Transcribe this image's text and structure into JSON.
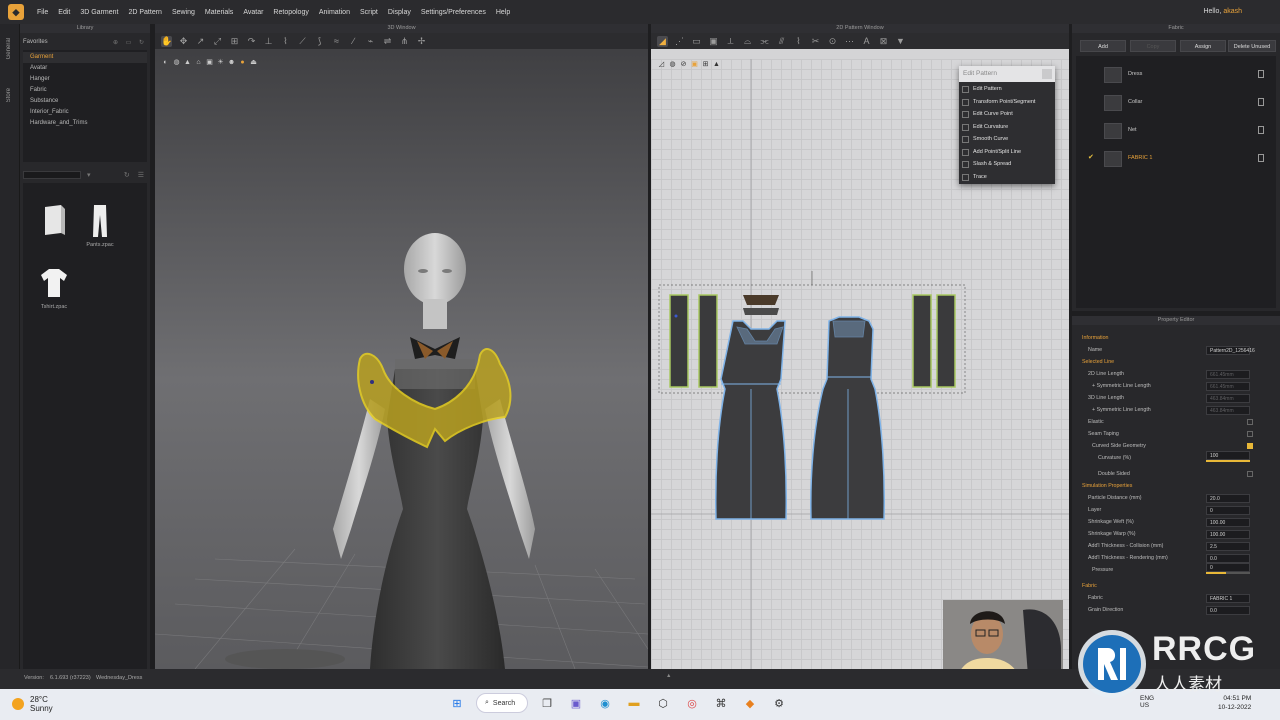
{
  "menubar": {
    "items": [
      "File",
      "Edit",
      "3D Garment",
      "2D Pattern",
      "Sewing",
      "Materials",
      "Avatar",
      "Retopology",
      "Animation",
      "Script",
      "Display",
      "Settings/Preferences",
      "Help"
    ],
    "greeting": "Hello,",
    "username": "akash"
  },
  "side_tabs": [
    "General",
    "Store"
  ],
  "library": {
    "header": "Library",
    "favorites_label": "Favorites",
    "tree": [
      "Garment",
      "Avatar",
      "Hanger",
      "Fabric",
      "Substance",
      "Interior_Fabric",
      "Hardware_and_Trims"
    ],
    "selected_tree_index": 0,
    "files": [
      {
        "name": ""
      },
      {
        "name": "Pants.zpac"
      },
      {
        "name": "Tshirt.zpac"
      }
    ]
  },
  "window3d": {
    "header": "3D Window"
  },
  "window2d": {
    "header": "2D Pattern Window",
    "popup": {
      "title": "Edit Pattern",
      "items": [
        "Edit Pattern",
        "Transform Point/Segment",
        "Edit Curve Point",
        "Edit Curvature",
        "Smooth Curve",
        "Add Point/Split Line",
        "Slash & Spread",
        "Trace"
      ]
    }
  },
  "fabric_panel": {
    "header": "Fabric",
    "buttons": {
      "add": "Add",
      "copy": "Copy",
      "assign": "Assign",
      "delete_unused": "Delete Unused"
    },
    "fabrics": [
      {
        "name": "Dress",
        "selected": false
      },
      {
        "name": "Collar",
        "selected": false
      },
      {
        "name": "Net",
        "selected": false
      },
      {
        "name": "FABRIC 1",
        "selected": true
      }
    ]
  },
  "property_editor": {
    "header": "Property Editor",
    "rows": [
      {
        "label": "Information",
        "type": "section"
      },
      {
        "label": "Name",
        "value": "Pattern2D_1256416"
      },
      {
        "label": "Selected Line",
        "type": "section"
      },
      {
        "label": "2D Line Length",
        "value": "661.45mm",
        "dim": true
      },
      {
        "label": "+ Symmetric Line Length",
        "value": "661.45mm",
        "dim": true,
        "sub": true
      },
      {
        "label": "3D Line Length",
        "value": "463.84mm",
        "dim": true
      },
      {
        "label": "+ Symmetric Line Length",
        "value": "463.84mm",
        "dim": true,
        "sub": true
      },
      {
        "label": "Elastic",
        "check": false
      },
      {
        "label": "Seam Taping",
        "check": false
      },
      {
        "label": "Curved Side Geometry",
        "check": true,
        "sub": true
      },
      {
        "label": "Curvature (%)",
        "value": "100",
        "slider": 1.0,
        "sub2": true
      },
      {
        "label": "Double Sided",
        "check": false,
        "sub2": true
      },
      {
        "label": "Simulation Properties",
        "type": "section"
      },
      {
        "label": "Particle Distance (mm)",
        "value": "20.0"
      },
      {
        "label": "Layer",
        "value": "0"
      },
      {
        "label": "Shrinkage Weft (%)",
        "value": "100.00"
      },
      {
        "label": "Shrinkage Warp (%)",
        "value": "100.00"
      },
      {
        "label": "Add'l Thickness - Collision (mm)",
        "value": "2.5"
      },
      {
        "label": "Add'l Thickness - Rendering (mm)",
        "value": "0.0"
      },
      {
        "label": "Pressure",
        "value": "0",
        "slider": 0.45,
        "sub": true
      },
      {
        "label": "Fabric",
        "type": "section"
      },
      {
        "label": "Fabric",
        "value": "FABRIC 1"
      },
      {
        "label": "Grain Direction",
        "value": "0.0"
      }
    ]
  },
  "statusbar": {
    "version_label": "Version:",
    "version": "6.1.693 (r37223)",
    "file": "Wednesday_Dress"
  },
  "taskbar": {
    "temperature": "28°C",
    "weather": "Sunny",
    "search": "Search",
    "language": "ENG",
    "region": "US",
    "time": "04:51 PM",
    "date": "10-12-2022"
  },
  "watermark": {
    "brand": "RRCG",
    "subtitle": "人人素材"
  },
  "colors": {
    "accent": "#e8a23a",
    "selection_yellow": "#e8d020",
    "pattern_outline": "#7fb3e8",
    "pattern_selected_outline": "#a8c860"
  }
}
